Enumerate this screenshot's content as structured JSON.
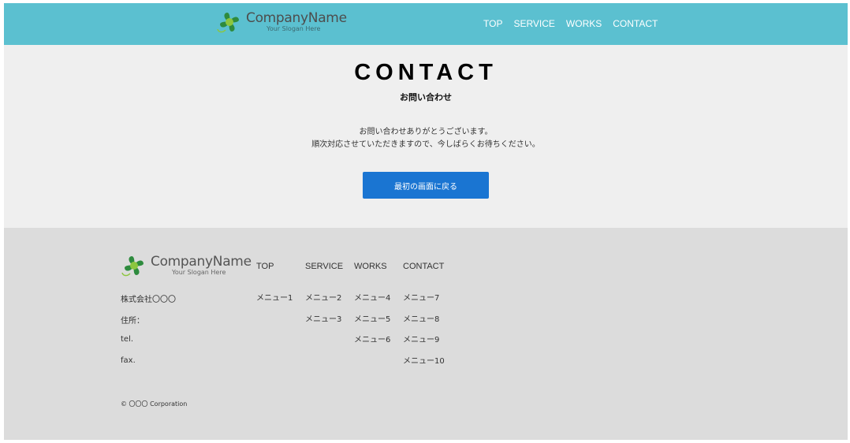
{
  "header": {
    "logo": {
      "name": "CompanyName",
      "slogan": "Your Slogan Here"
    },
    "nav": [
      "TOP",
      "SERVICE",
      "WORKS",
      "CONTACT"
    ]
  },
  "main": {
    "title": "CONTACT",
    "subtitle": "お問い合わせ",
    "message_line1": "お問い合わせありがとうございます。",
    "message_line2": "順次対応させていただきますので、今しばらくお待ちください。",
    "back_button": "最初の画面に戻る"
  },
  "footer": {
    "logo": {
      "name": "CompanyName",
      "slogan": "Your Slogan Here"
    },
    "company": {
      "name": "株式会社〇〇〇",
      "address": "住所：",
      "tel": "tel.",
      "fax": "fax."
    },
    "columns": [
      {
        "heading": "TOP",
        "items": [
          "メニュー1"
        ]
      },
      {
        "heading": "SERVICE",
        "items": [
          "メニュー2",
          "メニュー3"
        ]
      },
      {
        "heading": "WORKS",
        "items": [
          "メニュー4",
          "メニュー5",
          "メニュー6"
        ]
      },
      {
        "heading": "CONTACT",
        "items": [
          "メニュー7",
          "メニュー8",
          "メニュー9",
          "メニュー10"
        ]
      }
    ],
    "copyright": "© 〇〇〇 Corporation"
  },
  "colors": {
    "header_bg": "#5bc0d0",
    "main_bg": "#efefef",
    "footer_bg": "#dcdcdc",
    "button_bg": "#1a75d2",
    "logo_leaf": "#2e8b3e",
    "logo_leaf_light": "#8cc63f"
  },
  "icons": {
    "logo_mark": "clover-leaf-logo-icon"
  }
}
